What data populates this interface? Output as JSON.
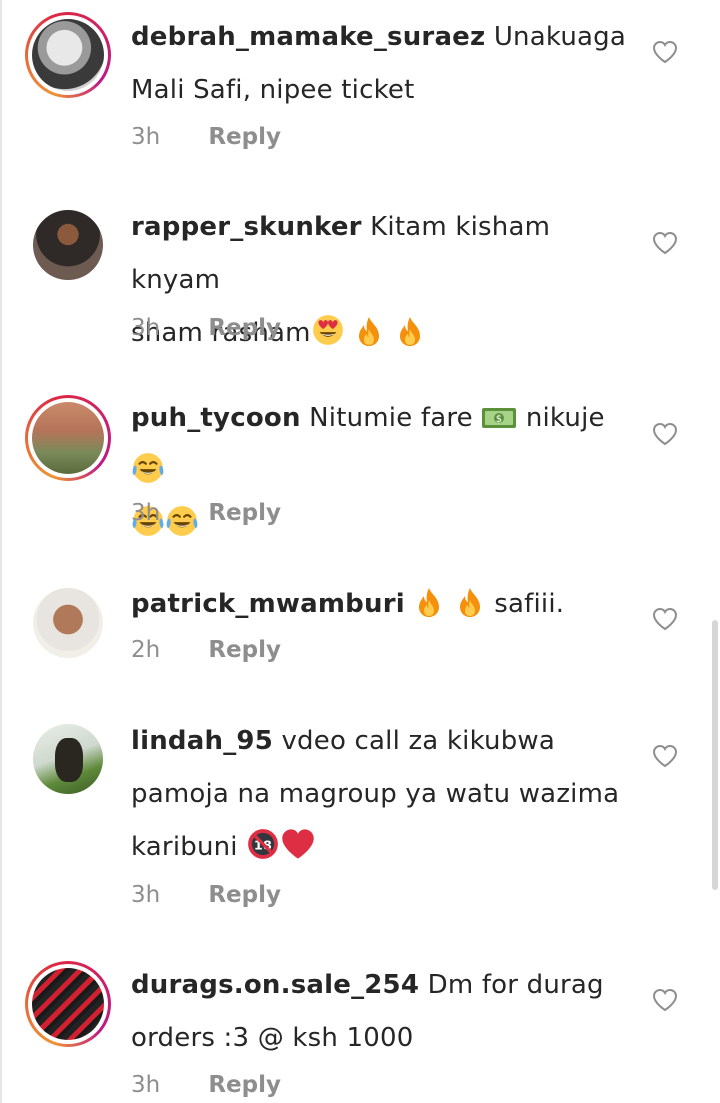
{
  "comments": [
    {
      "username": "debrah_mamake_suraez",
      "text_1": "Unakuaga",
      "text_2": "Mali Safi, nipee ticket",
      "time": "3h",
      "reply": "Reply",
      "avatar_style": "story"
    },
    {
      "username": "rapper_skunker",
      "text_1": "Kitam kisham knyam",
      "text_2": "sham rasham",
      "emojis": [
        "heart-eyes-emoji",
        "fire-emoji",
        "fire-emoji"
      ],
      "time": "3h",
      "reply": "Reply",
      "avatar_style": "plain"
    },
    {
      "username": "puh_tycoon",
      "text_1": "Nitumie fare",
      "text_1b": "nikuje",
      "emojis": [
        "money-emoji",
        "joy-emoji",
        "joy-emoji",
        "joy-emoji"
      ],
      "time": "3h",
      "reply": "Reply",
      "avatar_style": "story"
    },
    {
      "username": "patrick_mwamburi",
      "text_1": "safiii.",
      "emojis": [
        "fire-emoji",
        "fire-emoji"
      ],
      "time": "2h",
      "reply": "Reply",
      "avatar_style": "plain"
    },
    {
      "username": "lindah_95",
      "text_1": "vdeo call za kikubwa",
      "text_2": "pamoja na magroup ya watu wazima",
      "text_3": "karibuni",
      "emojis": [
        "no-under-18-emoji",
        "red-heart-emoji"
      ],
      "time": "3h",
      "reply": "Reply",
      "avatar_style": "plain"
    },
    {
      "username": "durags.on.sale_254",
      "text_1": "Dm for durag",
      "text_2": "orders :3 @ ksh 1000",
      "time": "3h",
      "reply": "Reply",
      "avatar_style": "story"
    }
  ],
  "colors": {
    "text": "#262626",
    "meta": "#8e8e8e",
    "heart_outline": "#8e8e8e"
  }
}
